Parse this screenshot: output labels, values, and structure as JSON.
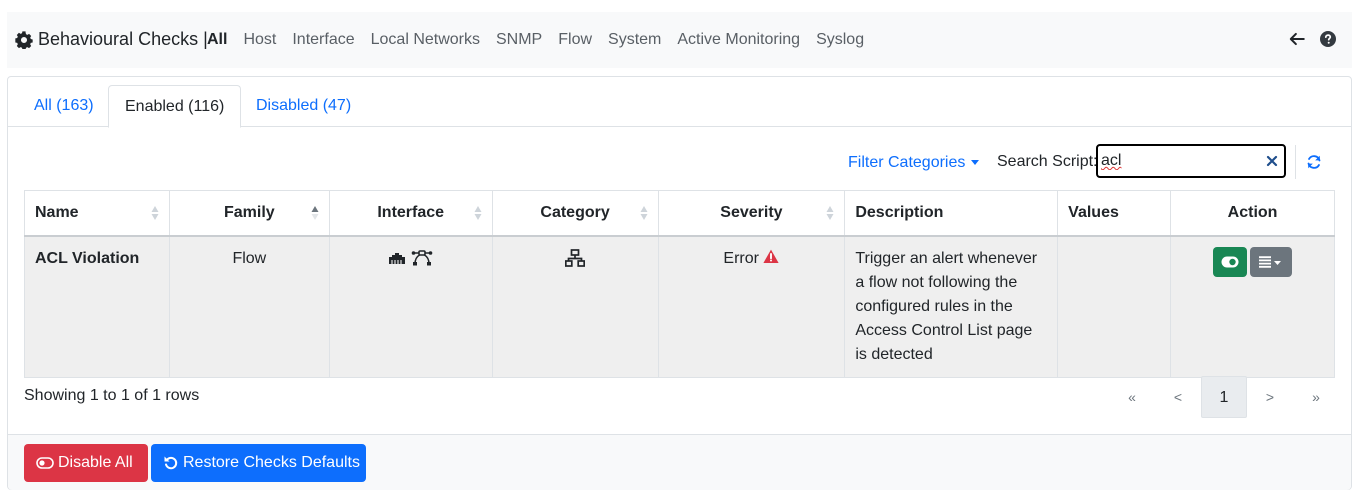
{
  "header": {
    "title": "Behavioural Checks",
    "separator": "|",
    "nav": [
      "All",
      "Host",
      "Interface",
      "Local Networks",
      "SNMP",
      "Flow",
      "System",
      "Active Monitoring",
      "Syslog"
    ],
    "active_nav": "All"
  },
  "tabs": [
    {
      "label": "All (163)"
    },
    {
      "label": "Enabled (116)"
    },
    {
      "label": "Disabled (47)"
    }
  ],
  "active_tab": "Enabled (116)",
  "filter": {
    "label": "Filter Categories"
  },
  "search": {
    "label": "Search Script:",
    "value": "acl"
  },
  "table": {
    "columns": [
      "Name",
      "Family",
      "Interface",
      "Category",
      "Severity",
      "Description",
      "Values",
      "Action"
    ],
    "rows": [
      {
        "name": "ACL Violation",
        "family": "Flow",
        "interface_icons": [
          "ethernet-icon",
          "bezier-curve-icon"
        ],
        "category_icon": "network-wired-icon",
        "severity": "Error",
        "description": "Trigger an alert whenever a flow not following the configured rules in the Access Control List page is detected",
        "values": ""
      }
    ]
  },
  "pagination": {
    "summary": "Showing 1 to 1 of 1 rows",
    "first": "«",
    "prev": "<",
    "current": "1",
    "next": ">",
    "last": "»"
  },
  "footer": {
    "disable_all": "Disable All",
    "restore_defaults": "Restore Checks Defaults"
  },
  "colors": {
    "link": "#0d6efd",
    "danger": "#dc3545",
    "success": "#198754",
    "secondary": "#6c757d"
  }
}
